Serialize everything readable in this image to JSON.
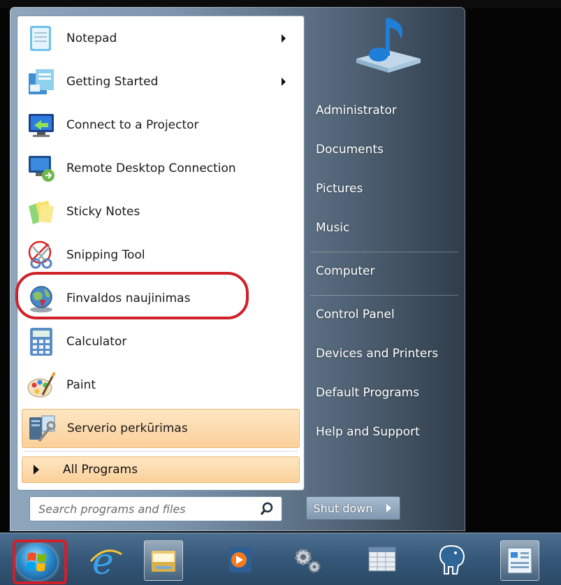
{
  "programs": [
    {
      "label": "Notepad",
      "icon": "notepad-icon",
      "submenu": true
    },
    {
      "label": "Getting Started",
      "icon": "getting-started-icon",
      "submenu": true
    },
    {
      "label": "Connect to a Projector",
      "icon": "projector-icon",
      "submenu": false
    },
    {
      "label": "Remote Desktop Connection",
      "icon": "remote-desktop-icon",
      "submenu": false
    },
    {
      "label": "Sticky Notes",
      "icon": "sticky-notes-icon",
      "submenu": false
    },
    {
      "label": "Snipping Tool",
      "icon": "snipping-tool-icon",
      "submenu": false
    },
    {
      "label": "Finvaldos naujinimas",
      "icon": "globe-update-icon",
      "submenu": false
    },
    {
      "label": "Calculator",
      "icon": "calculator-icon",
      "submenu": false
    },
    {
      "label": "Paint",
      "icon": "paint-icon",
      "submenu": false
    },
    {
      "label": "Serverio perkūrimas",
      "icon": "server-tool-icon",
      "submenu": false,
      "highlighted": true
    }
  ],
  "all_programs": {
    "label": "All Programs"
  },
  "search": {
    "placeholder": "Search programs and files"
  },
  "right_items": [
    {
      "label": "Administrator"
    },
    {
      "label": "Documents"
    },
    {
      "label": "Pictures"
    },
    {
      "label": "Music"
    },
    {
      "label": "Computer"
    },
    {
      "label": "Control Panel"
    },
    {
      "label": "Devices and Printers"
    },
    {
      "label": "Default Programs"
    },
    {
      "label": "Help and Support"
    }
  ],
  "shutdown": {
    "label": "Shut down"
  },
  "taskbar": {
    "items": [
      {
        "icon": "start-orb-icon"
      },
      {
        "icon": "internet-explorer-icon"
      },
      {
        "icon": "file-explorer-icon",
        "active": true
      },
      {
        "icon": "media-player-icon"
      },
      {
        "icon": "gears-icon"
      },
      {
        "icon": "spreadsheet-app-icon"
      },
      {
        "icon": "postgresql-elephant-icon"
      },
      {
        "icon": "control-panel-icon",
        "active": true
      }
    ]
  },
  "colors": {
    "highlight": "#fbd09a",
    "annotation_red": "#d0202a",
    "taskbar": "#355778"
  }
}
